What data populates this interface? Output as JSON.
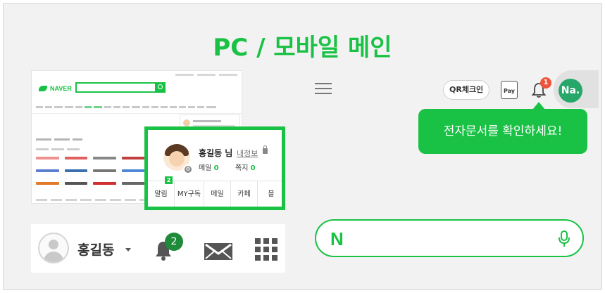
{
  "title": "PC / 모바일 메인",
  "colors": {
    "brand": "#19c245",
    "badge_red": "#f0533a",
    "avatar_green": "#27a76a"
  },
  "pc_thumbnail": {
    "logo_text": "NAVER",
    "icons": [
      "search-icon"
    ]
  },
  "login_box": {
    "name": "홍길동 님",
    "my_info_link": "내정보",
    "mail_label": "메일",
    "mail_count": "0",
    "note_label": "쪽지",
    "note_count": "0",
    "tab_badge": "2",
    "tabs": [
      "알림",
      "MY구독",
      "메일",
      "카페",
      "블"
    ]
  },
  "pc_bar": {
    "user_name": "홍길동",
    "notification_count": "2",
    "icons": [
      "avatar-icon",
      "bell-icon",
      "mail-icon",
      "apps-grid-icon"
    ]
  },
  "mobile": {
    "qr_button": "QR체크인",
    "pay_label": "Pay",
    "bell_badge": "1",
    "avatar_text": "Na.",
    "tooltip": "전자문서를 확인하세요!",
    "search_logo": "N",
    "icons": [
      "menu-icon",
      "bell-icon",
      "mic-icon"
    ]
  }
}
